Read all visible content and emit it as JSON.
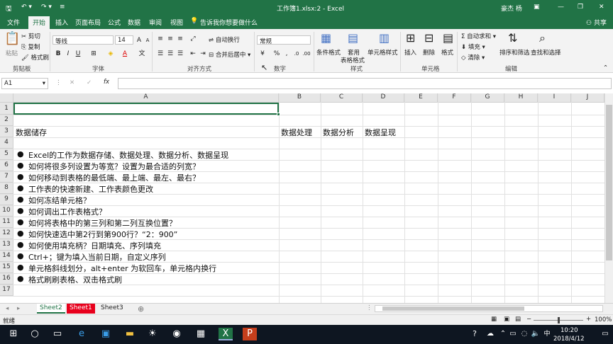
{
  "titlebar": {
    "title": "工作簿1.xlsx:2  -  Excel",
    "user": "豪杰 杨"
  },
  "tabs": [
    {
      "label": "文件"
    },
    {
      "label": "开始"
    },
    {
      "label": "插入"
    },
    {
      "label": "页面布局"
    },
    {
      "label": "公式"
    },
    {
      "label": "数据"
    },
    {
      "label": "审阅"
    },
    {
      "label": "视图"
    }
  ],
  "tell_me": "告诉我你想要做什么",
  "share": "共享",
  "ribbon": {
    "clipboard": {
      "paste": "粘贴",
      "cut": "剪切",
      "copy": "复制",
      "format_painter": "格式刷",
      "group": "剪贴板"
    },
    "font": {
      "name": "等线",
      "size": "14",
      "group": "字体"
    },
    "alignment": {
      "wrap": "自动换行",
      "merge": "合并后居中",
      "group": "对齐方式"
    },
    "number": {
      "format": "常规",
      "group": "数字"
    },
    "styles": {
      "cond": "条件格式",
      "table": "套用",
      "table2": "表格格式",
      "cell": "单元格样式",
      "group": "样式"
    },
    "cells": {
      "insert": "插入",
      "delete": "删除",
      "format": "格式",
      "group": "单元格"
    },
    "editing": {
      "autosum": "自动求和",
      "fill": "填充",
      "clear": "清除",
      "sort": "排序和筛选",
      "find": "查找和选择",
      "group": "编辑"
    }
  },
  "namebox": "A1",
  "formula": "",
  "columns": [
    "A",
    "B",
    "C",
    "D",
    "E",
    "F",
    "G",
    "H",
    "I",
    "J"
  ],
  "rows": [
    "1",
    "2",
    "3",
    "4",
    "5",
    "6",
    "7",
    "8",
    "9",
    "10",
    "11",
    "12",
    "13",
    "14",
    "15",
    "16",
    "17"
  ],
  "cells": {
    "a3": "数据储存",
    "b3": "数据处理",
    "c3": "数据分析",
    "d3": "数据呈现",
    "bullets": [
      "Excel的工作为数据存储、数据处理、数据分析、数据呈现",
      "如何将很多列设置为等宽？设置为最合适的列宽？",
      "如何移动到表格的最低端、最上端、最左、最右？",
      "工作表的快速新建、工作表颜色更改",
      "如何冻结单元格？",
      "如何调出工作表格式？",
      "如何将表格中的第三列和第二列互换位置？",
      "如何快速选中第2行到第900行？“2：900”",
      "如何使用填充柄？日期填充、序列填充",
      "Ctrl+；键为填入当前日期，自定义序列",
      "单元格斜线划分，alt+enter 为软回车，单元格内换行",
      "格式刷刷表格、双击格式刷"
    ],
    "bullet_glyph": "●"
  },
  "sheets": [
    {
      "label": "Sheet2"
    },
    {
      "label": "Sheet1"
    },
    {
      "label": "Sheet3"
    }
  ],
  "status": {
    "ready": "就绪",
    "zoom": "100%"
  },
  "taskbar": {
    "ime": "中",
    "time": "10:20",
    "date": "2018/4/12"
  },
  "colors": {
    "excel_green": "#217346",
    "sheet1_tab": "#e8001c",
    "selection": "#217346"
  }
}
